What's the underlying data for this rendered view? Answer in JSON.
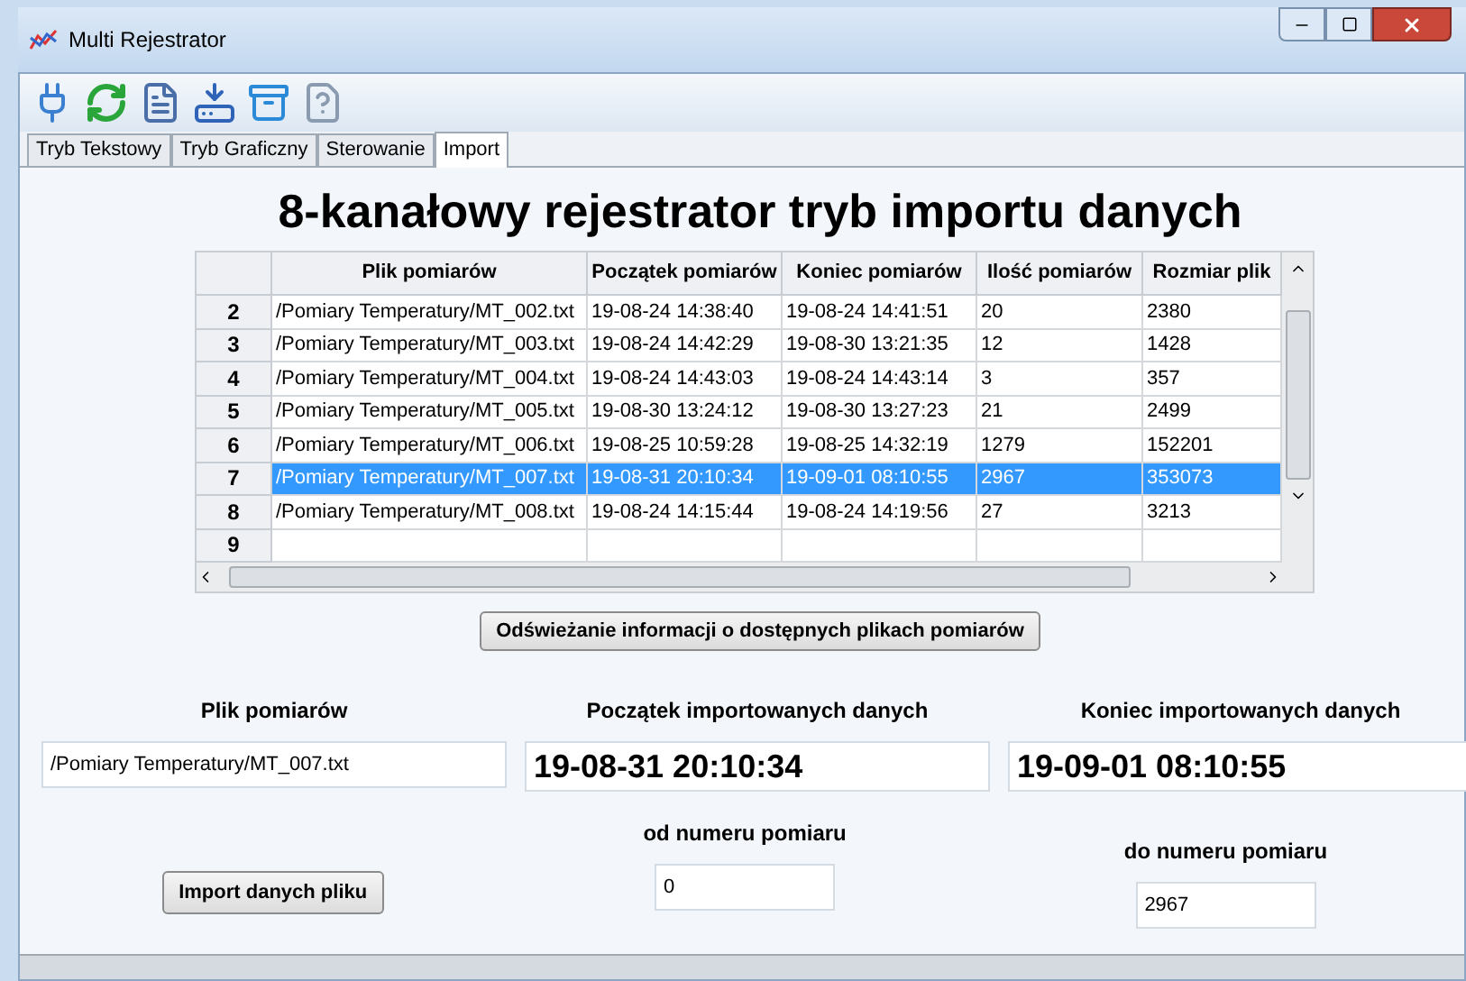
{
  "window": {
    "title": "Multi Rejestrator"
  },
  "tabs": [
    {
      "label": "Tryb Tekstowy",
      "selected": false
    },
    {
      "label": "Tryb Graficzny",
      "selected": false
    },
    {
      "label": "Sterowanie",
      "selected": false
    },
    {
      "label": "Import",
      "selected": true
    }
  ],
  "heading": "8-kanałowy rejestrator tryb importu danych",
  "table": {
    "columns": [
      "Plik pomiarów",
      "Początek pomiarów",
      "Koniec pomiarów",
      "Ilość pomiarów",
      "Rozmiar plik"
    ],
    "rows": [
      {
        "number": "2",
        "cells": [
          "/Pomiary Temperatury/MT_002.txt",
          "19-08-24 14:38:40",
          "19-08-24 14:41:51",
          "20",
          "2380"
        ],
        "selected": false
      },
      {
        "number": "3",
        "cells": [
          "/Pomiary Temperatury/MT_003.txt",
          "19-08-24 14:42:29",
          "19-08-30 13:21:35",
          "12",
          "1428"
        ],
        "selected": false
      },
      {
        "number": "4",
        "cells": [
          "/Pomiary Temperatury/MT_004.txt",
          "19-08-24 14:43:03",
          "19-08-24 14:43:14",
          "3",
          "357"
        ],
        "selected": false
      },
      {
        "number": "5",
        "cells": [
          "/Pomiary Temperatury/MT_005.txt",
          "19-08-30 13:24:12",
          "19-08-30 13:27:23",
          "21",
          "2499"
        ],
        "selected": false
      },
      {
        "number": "6",
        "cells": [
          "/Pomiary Temperatury/MT_006.txt",
          "19-08-25 10:59:28",
          "19-08-25 14:32:19",
          "1279",
          "152201"
        ],
        "selected": false
      },
      {
        "number": "7",
        "cells": [
          "/Pomiary Temperatury/MT_007.txt",
          "19-08-31 20:10:34",
          "19-09-01 08:10:55",
          "2967",
          "353073"
        ],
        "selected": true
      },
      {
        "number": "8",
        "cells": [
          "/Pomiary Temperatury/MT_008.txt",
          "19-08-24 14:15:44",
          "19-08-24 14:19:56",
          "27",
          "3213"
        ],
        "selected": false
      },
      {
        "number": "9",
        "cells": [
          "",
          "",
          "",
          "",
          ""
        ],
        "selected": false
      }
    ]
  },
  "refresh_button": "Odświeżanie informacji o dostępnych plikach pomiarów",
  "file": {
    "label": "Plik pomiarów",
    "value": "/Pomiary Temperatury/MT_007.txt"
  },
  "start": {
    "label": "Początek importowanych danych",
    "value": "19-08-31 20:10:34"
  },
  "end": {
    "label": "Koniec importowanych danych",
    "value": "19-09-01 08:10:55"
  },
  "import_button": "Import danych pliku",
  "from": {
    "label": "od numeru pomiaru",
    "value": "0"
  },
  "to": {
    "label": "do numeru pomiaru",
    "value": "2967"
  }
}
